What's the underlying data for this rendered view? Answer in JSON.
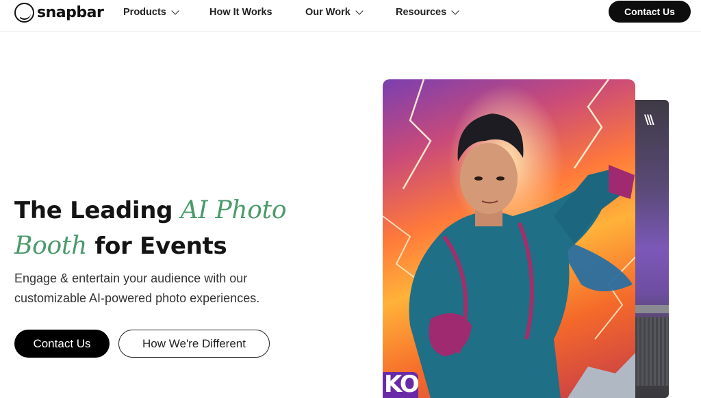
{
  "brand": {
    "name": "snapbar"
  },
  "nav": {
    "items": [
      {
        "label": "Products",
        "has_dropdown": true
      },
      {
        "label": "How It Works",
        "has_dropdown": false
      },
      {
        "label": "Our Work",
        "has_dropdown": true
      },
      {
        "label": "Resources",
        "has_dropdown": true
      }
    ],
    "cta_label": "Contact Us"
  },
  "hero": {
    "title_part1": "The Leading ",
    "title_accent1": "AI Photo",
    "title_accent2": "Booth",
    "title_part2": " for Events",
    "subtitle": "Engage & entertain your audience with our customizable AI-powered photo experiences.",
    "primary_button": "Contact Us",
    "secondary_button": "How We're Different",
    "badge_text": "KO"
  },
  "colors": {
    "accent_green": "#4a9a6a",
    "button_dark": "#000000",
    "badge_purple": "#6a2aa8"
  }
}
